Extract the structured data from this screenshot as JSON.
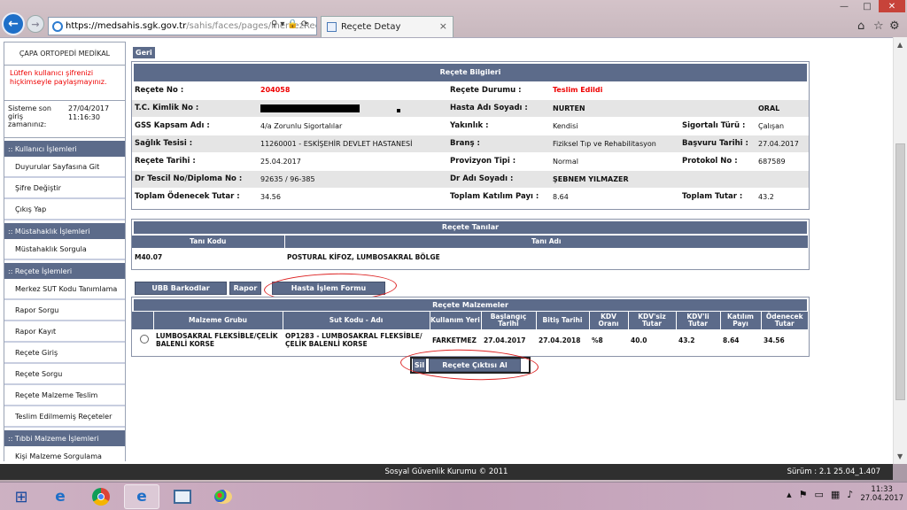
{
  "browser": {
    "url_host": "https://medsahis.sgk.gov.tr",
    "url_path": "/sahis/faces/pages/merkezRece",
    "tab_title": "Reçete Detay",
    "tab_close": "×",
    "back": "←",
    "forward": "→",
    "win_min": "—",
    "win_max": "□",
    "win_close": "✕"
  },
  "sidebar": {
    "org": "ÇAPA ORTOPEDİ MEDİKAL",
    "warning": "Lütfen kullanıcı şifrenizi hiçkimseyle paylaşmayınız.",
    "last_login_label": "Sisteme son giriş zamanınız:",
    "last_login_date": "27/04/2017",
    "last_login_time": "11:16:30",
    "sections": [
      {
        "title": ":: Kullanıcı İşlemleri",
        "items": [
          "Duyurular Sayfasına Git",
          "Şifre Değiştir",
          "Çıkış Yap"
        ]
      },
      {
        "title": ":: Müstahaklık İşlemleri",
        "items": [
          "Müstahaklık Sorgula"
        ]
      },
      {
        "title": ":: Reçete İşlemleri",
        "items": [
          "Merkez SUT Kodu Tanımlama",
          "Rapor Sorgu",
          "Rapor Kayıt",
          "Reçete Giriş",
          "Reçete Sorgu",
          "Reçete Malzeme Teslim",
          "Teslim Edilmemiş Reçeteler"
        ]
      },
      {
        "title": ":: Tıbbi Malzeme İşlemleri",
        "items": [
          "Kişi Malzeme Sorgulama"
        ]
      }
    ]
  },
  "main": {
    "back_label": "Geri",
    "info_title": "Reçete Bilgileri",
    "info": {
      "recete_no_label": "Reçete No :",
      "recete_no": "204058",
      "durum_label": "Reçete Durumu :",
      "durum": "Teslim Edildi",
      "tc_label": "T.C. Kimlik No :",
      "hasta_label": "Hasta Adı Soyadı :",
      "hasta_ad": "NURTEN",
      "hasta_soyad": "ORAL",
      "gss_label": "GSS Kapsam Adı :",
      "gss": "4/a Zorunlu Sigortalılar",
      "yakinlik_label": "Yakınlık :",
      "yakinlik": "Kendisi",
      "sigortali_label": "Sigortalı Türü :",
      "sigortali": "Çalışan",
      "tesis_label": "Sağlık Tesisi :",
      "tesis": "11260001 - ESKİŞEHİR DEVLET HASTANESİ",
      "brans_label": "Branş :",
      "brans": "Fiziksel Tıp ve Rehabilitasyon",
      "basvuru_label": "Başvuru Tarihi :",
      "basvuru": "27.04.2017",
      "recete_tarihi_label": "Reçete Tarihi :",
      "recete_tarihi": "25.04.2017",
      "provizyon_label": "Provizyon Tipi :",
      "provizyon": "Normal",
      "protokol_label": "Protokol No :",
      "protokol": "687589",
      "tescil_label": "Dr Tescil No/Diploma No :",
      "tescil": "92635 / 96-385",
      "dr_label": "Dr Adı Soyadı :",
      "dr": "ŞEBNEM YILMAZER",
      "odenecek_label": "Toplam Ödenecek Tutar :",
      "odenecek": "34.56",
      "katilim_label": "Toplam Katılım Payı :",
      "katilim": "8.64",
      "toplam_label": "Toplam Tutar :",
      "toplam": "43.2"
    },
    "diag_title": "Reçete Tanılar",
    "diag_headers": [
      "Tanı Kodu",
      "Tanı Adı"
    ],
    "diag_row": {
      "code": "M40.07",
      "name": "POSTURAL KİFOZ, LUMBOSAKRAL BÖLGE"
    },
    "buttons": {
      "ubb": "UBB Barkodlar",
      "rapor": "Rapor",
      "hasta_form": "Hasta İşlem Formu",
      "sil": "Sil",
      "cikti": "Reçete Çıktısı Al"
    },
    "mat_title": "Reçete Malzemeler",
    "mat_headers": [
      "Malzeme Grubu",
      "Sut Kodu - Adı",
      "Kullanım Yeri",
      "Başlangıç Tarihi",
      "Bitiş Tarihi",
      "KDV Oranı",
      "KDV'siz Tutar",
      "KDV'li Tutar",
      "Katılım Payı",
      "Ödenecek Tutar"
    ],
    "mat_row": {
      "grup": "LUMBOSAKRAL FLEKSİBLE/ÇELİK BALENLİ KORSE",
      "sut": "OP1283 - LUMBOSAKRAL FLEKSİBLE/ÇELİK BALENLİ KORSE",
      "yer": "FARKETMEZ",
      "baslangic": "27.04.2017",
      "bitis": "27.04.2018",
      "kdv_orani": "%8",
      "kdvsiz": "40.0",
      "kdvli": "43.2",
      "katilim": "8.64",
      "odenecek": "34.56"
    }
  },
  "footer": {
    "copyright": "Sosyal Güvenlik Kurumu © 2011",
    "version": "Sürüm : 2.1 25.04_1.407"
  },
  "taskbar": {
    "time": "11:33",
    "date": "27.04.2017"
  },
  "colors": {
    "header": "#5c6b8a",
    "alert": "#ee0000",
    "annotation": "#dd2222"
  }
}
